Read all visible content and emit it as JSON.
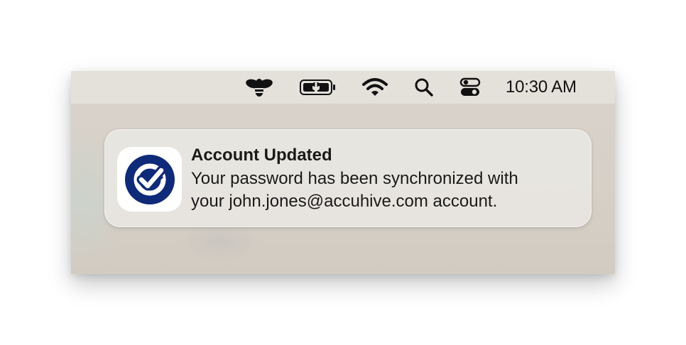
{
  "menubar": {
    "icons": [
      {
        "name": "bee-app-icon"
      },
      {
        "name": "battery-charging-icon"
      },
      {
        "name": "wifi-icon"
      },
      {
        "name": "spotlight-search-icon"
      },
      {
        "name": "control-center-icon"
      }
    ],
    "clock": "10:30 AM"
  },
  "notification": {
    "app_icon": "checkmark-shield-icon",
    "title": "Account Updated",
    "body_line1": "Your password has been synchronized with",
    "body_line2": "your john.jones@accuhive.com account."
  },
  "colors": {
    "icon_navy": "#0e2a78",
    "menubar": "#e4e0da",
    "desktop": "#d6d0c7"
  }
}
